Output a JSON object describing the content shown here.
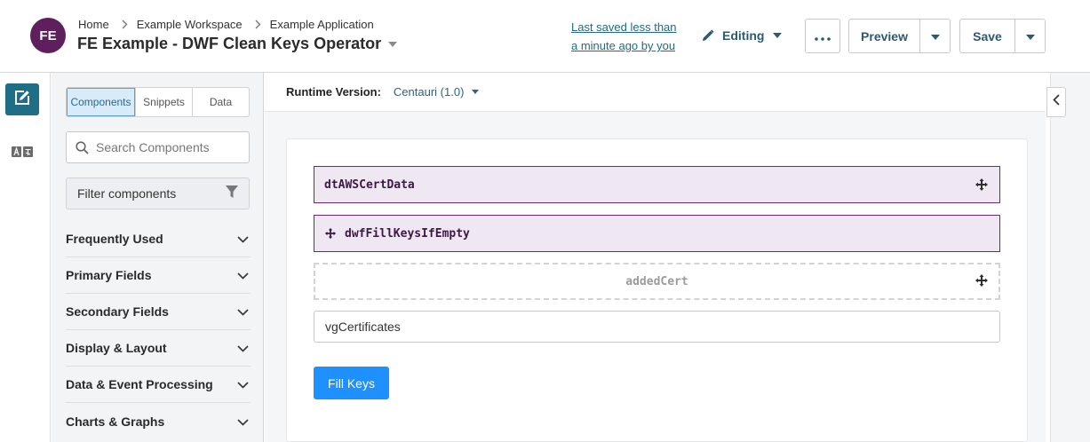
{
  "header": {
    "avatar_initials": "FE",
    "breadcrumb": [
      "Home",
      "Example Workspace",
      "Example Application"
    ],
    "title": "FE Example - DWF Clean Keys Operator",
    "last_saved": "Last saved less than a minute ago by you",
    "mode": "Editing",
    "preview_label": "Preview",
    "save_label": "Save"
  },
  "left_rail": {
    "icons": [
      "edit-icon",
      "translate-icon"
    ],
    "active_color": "#1e6f86"
  },
  "panel": {
    "tabs": [
      {
        "label": "Components",
        "active": true
      },
      {
        "label": "Snippets",
        "active": false
      },
      {
        "label": "Data",
        "active": false
      }
    ],
    "search_placeholder": "Search Components",
    "filter_label": "Filter components",
    "categories": [
      "Frequently Used",
      "Primary Fields",
      "Secondary Fields",
      "Display & Layout",
      "Data & Event Processing",
      "Charts & Graphs"
    ]
  },
  "canvas": {
    "runtime_label": "Runtime Version:",
    "runtime_value": "Centauri (1.0)",
    "components": [
      {
        "name": "dtAWSCertData",
        "style": "selected"
      },
      {
        "name": "dwfFillKeysIfEmpty",
        "style": "selected"
      },
      {
        "name": "addedCert",
        "style": "hidden-placeholder"
      }
    ],
    "input_value": "vgCertificates",
    "fill_button_label": "Fill Keys"
  },
  "colors": {
    "brand_avatar": "#5e1f5c",
    "accent": "#1e6f86",
    "primary_button": "#1e90ff",
    "component_border": "#6a2a73",
    "component_bg": "#efe8f2"
  }
}
